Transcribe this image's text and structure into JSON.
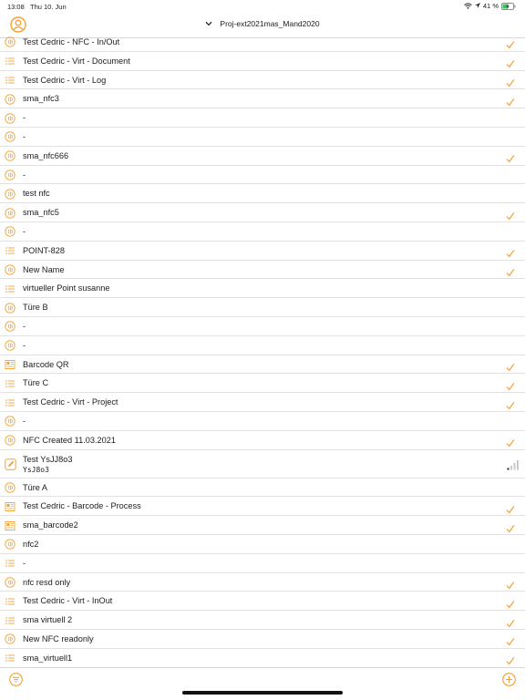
{
  "status_bar": {
    "time": "13:08",
    "date": "Thu 10. Jun",
    "battery": "41 %"
  },
  "header": {
    "title": "Proj-ext2021mas_Mand2020"
  },
  "colors": {
    "accent": "#f5a031",
    "text": "#1c1c1e",
    "separator": "#e2e2e6"
  },
  "items": [
    {
      "label": "Test Cedric - NFC - In/Out",
      "icon": "nfc-icon",
      "status": "check"
    },
    {
      "label": "Test Cedric - Virt - Document",
      "icon": "list-icon",
      "status": "check"
    },
    {
      "label": "Test Cedric - Virt - Log",
      "icon": "list-icon",
      "status": "check"
    },
    {
      "label": "sma_nfc3",
      "icon": "nfc-icon",
      "status": "check"
    },
    {
      "label": "-",
      "icon": "nfc-icon",
      "status": "none"
    },
    {
      "label": "-",
      "icon": "nfc-icon",
      "status": "none"
    },
    {
      "label": "sma_nfc666",
      "icon": "nfc-icon",
      "status": "check"
    },
    {
      "label": "-",
      "icon": "nfc-icon",
      "status": "none"
    },
    {
      "label": "test nfc",
      "icon": "nfc-icon",
      "status": "none"
    },
    {
      "label": "sma_nfc5",
      "icon": "nfc-icon",
      "status": "check"
    },
    {
      "label": "-",
      "icon": "nfc-icon",
      "status": "none"
    },
    {
      "label": "POINT-828",
      "icon": "list-icon",
      "status": "check"
    },
    {
      "label": "New Name",
      "icon": "nfc-icon",
      "status": "check"
    },
    {
      "label": "virtueller Point susanne",
      "icon": "list-icon",
      "status": "none"
    },
    {
      "label": "Türe B",
      "icon": "nfc-icon",
      "status": "none"
    },
    {
      "label": "-",
      "icon": "nfc-icon",
      "status": "none"
    },
    {
      "label": "-",
      "icon": "nfc-icon",
      "status": "none"
    },
    {
      "label": "Barcode QR",
      "icon": "barcode-icon",
      "status": "check"
    },
    {
      "label": "Türe C",
      "icon": "list-icon",
      "status": "check"
    },
    {
      "label": "Test Cedric - Virt - Project",
      "icon": "list-icon",
      "status": "check"
    },
    {
      "label": "-",
      "icon": "nfc-icon",
      "status": "none"
    },
    {
      "label": "NFC Created 11.03.2021",
      "icon": "nfc-icon",
      "status": "check"
    },
    {
      "label": "Test YsJJ8o3",
      "sublabel": "YsJ8o3",
      "icon": "note-icon",
      "status": "signal",
      "tall": true
    },
    {
      "label": "Türe A",
      "icon": "nfc-icon",
      "status": "none"
    },
    {
      "label": "Test Cedric - Barcode - Process",
      "icon": "barcode-icon",
      "status": "check"
    },
    {
      "label": "sma_barcode2",
      "icon": "barcode-icon",
      "status": "check"
    },
    {
      "label": "nfc2",
      "icon": "nfc-icon",
      "status": "none"
    },
    {
      "label": "-",
      "icon": "list-icon",
      "status": "none"
    },
    {
      "label": "nfc resd only",
      "icon": "nfc-icon",
      "status": "check"
    },
    {
      "label": "Test Cedric - Virt - InOut",
      "icon": "list-icon",
      "status": "check"
    },
    {
      "label": "sma virtuell 2",
      "icon": "list-icon",
      "status": "check"
    },
    {
      "label": "New NFC readonly",
      "icon": "nfc-icon",
      "status": "check"
    },
    {
      "label": "sma_virtuell1",
      "icon": "list-icon",
      "status": "check"
    }
  ]
}
